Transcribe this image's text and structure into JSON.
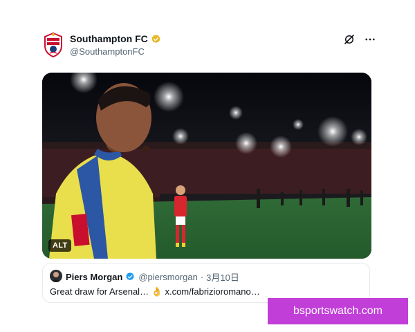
{
  "tweet": {
    "author": {
      "display_name": "Southampton FC",
      "handle": "@SouthamptonFC",
      "verified_badge": "gold-verified-icon",
      "avatar_icon": "club-crest-icon"
    },
    "header_icons": [
      "grok-icon",
      "more-icon"
    ],
    "media": {
      "alt_label": "ALT",
      "description_icon": "video-frame"
    },
    "quote": {
      "display_name": "Piers Morgan",
      "handle": "@piersmorgan",
      "separator": "·",
      "date": "3月10日",
      "text": "Great draw for Arsenal… 👌 x.com/fabrizioromano…",
      "verified_badge": "blue-verified-icon"
    }
  },
  "watermark": {
    "text": "bsportswatch.com",
    "color": "#c13ed8"
  },
  "colors": {
    "verified_gold": "#e8b829",
    "verified_blue": "#1d9bf0",
    "muted_text": "#536471",
    "border": "#e6e9ec"
  }
}
